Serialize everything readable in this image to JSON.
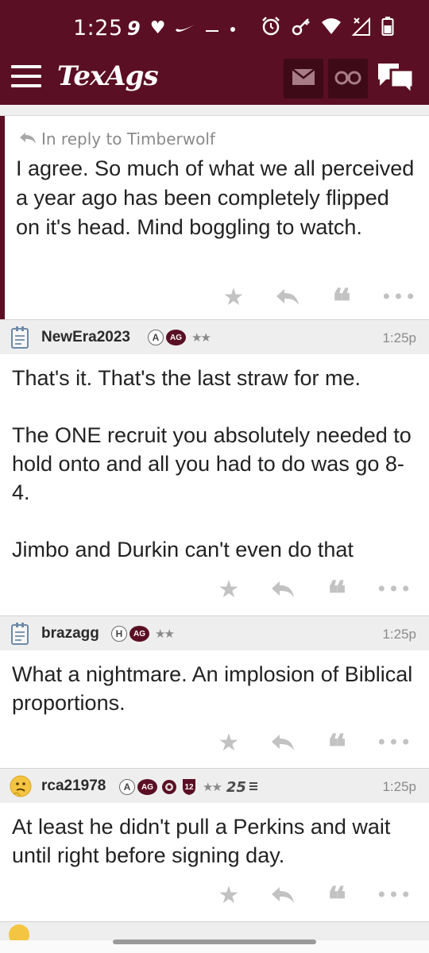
{
  "status_bar": {
    "time": "1:25",
    "left_icons": [
      "nfl-49ers-icon",
      "heart-icon",
      "nike-swoosh-icon",
      "dash-icon",
      "dot-icon"
    ],
    "right_icons": [
      "alarm-icon",
      "key-icon",
      "wifi-icon",
      "no-signal-icon",
      "battery-icon"
    ]
  },
  "header": {
    "logo": "TexAgs",
    "menu_icon": "hamburger-icon",
    "buttons": [
      "mail-icon",
      "binoculars-icon",
      "chat-bubbles-icon"
    ],
    "colors": {
      "brand": "#5b0f24",
      "button_bg": "#3e0a18"
    }
  },
  "reply_post": {
    "reply_to": "In reply to Timberwolf",
    "body": "I agree. So much of what we all perceived a year ago has been completely flipped on it's head. Mind boggling to watch."
  },
  "posts": [
    {
      "username": "NewEra2023",
      "badge_letter": "A",
      "badge_ag": "AG",
      "stars": "★★",
      "time": "1:25p",
      "avatar": "notepad-icon",
      "body": "That's it. That's the last straw for me.\n\nThe ONE recruit you absolutely needed to hold onto and all you had to do was go 8-4.\n\nJimbo and Durkin can't even do that"
    },
    {
      "username": "brazagg",
      "badge_letter": "H",
      "badge_ag": "AG",
      "stars": "★★",
      "time": "1:25p",
      "avatar": "notepad-icon",
      "body": "What a nightmare. An implosion of Biblical proportions."
    },
    {
      "username": "rca21978",
      "badge_letter": "A",
      "badge_ag": "AG",
      "stars": "★★",
      "extra_badge_num": "12",
      "extra_badge_25": "25",
      "time": "1:25p",
      "avatar": "thinking-emoji-icon",
      "body": "At least he didn't pull a Perkins and wait until right before signing day."
    }
  ],
  "actions": {
    "icons": [
      "star-icon",
      "reply-icon",
      "quote-icon",
      "more-icon"
    ],
    "quote_glyph": "❝",
    "star_glyph": "★",
    "more_glyph": "•••"
  }
}
